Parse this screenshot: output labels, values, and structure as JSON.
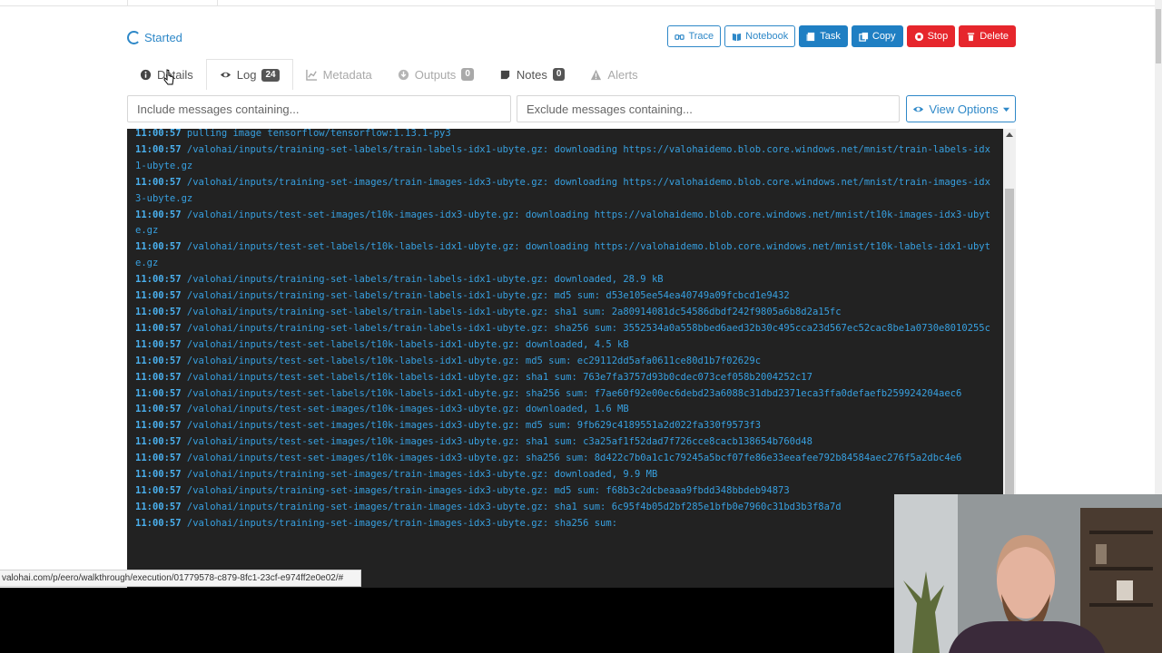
{
  "status": {
    "label": "Started"
  },
  "actions": [
    {
      "label": "Trace",
      "icon": "trace-icon",
      "style": "outline"
    },
    {
      "label": "Notebook",
      "icon": "book-icon",
      "style": "outline"
    },
    {
      "label": "Task",
      "icon": "task-icon",
      "style": "blue"
    },
    {
      "label": "Copy",
      "icon": "copy-icon",
      "style": "blue"
    },
    {
      "label": "Stop",
      "icon": "stop-icon",
      "style": "red"
    },
    {
      "label": "Delete",
      "icon": "trash-icon",
      "style": "red"
    }
  ],
  "tabs": [
    {
      "label": "Details",
      "icon": "info-icon",
      "badge": ""
    },
    {
      "label": "Log",
      "icon": "eye-icon",
      "badge": "24"
    },
    {
      "label": "Metadata",
      "icon": "chart-icon",
      "badge": ""
    },
    {
      "label": "Outputs",
      "icon": "download-icon",
      "badge": "0"
    },
    {
      "label": "Notes",
      "icon": "note-icon",
      "badge": "0"
    },
    {
      "label": "Alerts",
      "icon": "warning-icon",
      "badge": ""
    }
  ],
  "filters": {
    "include_placeholder": "Include messages containing...",
    "exclude_placeholder": "Exclude messages containing...",
    "view_options_label": "View Options"
  },
  "log_lines": [
    {
      "time": "11:00:57",
      "text": "pulling image tensorflow/tensorflow:1.13.1-py3"
    },
    {
      "time": "11:00:57",
      "text": "/valohai/inputs/training-set-labels/train-labels-idx1-ubyte.gz: downloading https://valohaidemo.blob.core.windows.net/mnist/train-labels-idx1-ubyte.gz"
    },
    {
      "time": "11:00:57",
      "text": "/valohai/inputs/training-set-images/train-images-idx3-ubyte.gz: downloading https://valohaidemo.blob.core.windows.net/mnist/train-images-idx3-ubyte.gz"
    },
    {
      "time": "11:00:57",
      "text": "/valohai/inputs/test-set-images/t10k-images-idx3-ubyte.gz: downloading https://valohaidemo.blob.core.windows.net/mnist/t10k-images-idx3-ubyte.gz"
    },
    {
      "time": "11:00:57",
      "text": "/valohai/inputs/test-set-labels/t10k-labels-idx1-ubyte.gz: downloading https://valohaidemo.blob.core.windows.net/mnist/t10k-labels-idx1-ubyte.gz"
    },
    {
      "time": "11:00:57",
      "text": "/valohai/inputs/training-set-labels/train-labels-idx1-ubyte.gz: downloaded, 28.9 kB"
    },
    {
      "time": "11:00:57",
      "text": "/valohai/inputs/training-set-labels/train-labels-idx1-ubyte.gz: md5 sum: d53e105ee54ea40749a09fcbcd1e9432"
    },
    {
      "time": "11:00:57",
      "text": "/valohai/inputs/training-set-labels/train-labels-idx1-ubyte.gz: sha1 sum: 2a80914081dc54586dbdf242f9805a6b8d2a15fc"
    },
    {
      "time": "11:00:57",
      "text": "/valohai/inputs/training-set-labels/train-labels-idx1-ubyte.gz: sha256 sum: 3552534a0a558bbed6aed32b30c495cca23d567ec52cac8be1a0730e8010255c"
    },
    {
      "time": "11:00:57",
      "text": "/valohai/inputs/test-set-labels/t10k-labels-idx1-ubyte.gz: downloaded, 4.5 kB"
    },
    {
      "time": "11:00:57",
      "text": "/valohai/inputs/test-set-labels/t10k-labels-idx1-ubyte.gz: md5 sum: ec29112dd5afa0611ce80d1b7f02629c"
    },
    {
      "time": "11:00:57",
      "text": "/valohai/inputs/test-set-labels/t10k-labels-idx1-ubyte.gz: sha1 sum: 763e7fa3757d93b0cdec073cef058b2004252c17"
    },
    {
      "time": "11:00:57",
      "text": "/valohai/inputs/test-set-labels/t10k-labels-idx1-ubyte.gz: sha256 sum: f7ae60f92e00ec6debd23a6088c31dbd2371eca3ffa0defaefb259924204aec6"
    },
    {
      "time": "11:00:57",
      "text": "/valohai/inputs/test-set-images/t10k-images-idx3-ubyte.gz: downloaded, 1.6 MB"
    },
    {
      "time": "11:00:57",
      "text": "/valohai/inputs/test-set-images/t10k-images-idx3-ubyte.gz: md5 sum: 9fb629c4189551a2d022fa330f9573f3"
    },
    {
      "time": "11:00:57",
      "text": "/valohai/inputs/test-set-images/t10k-images-idx3-ubyte.gz: sha1 sum: c3a25af1f52dad7f726cce8cacb138654b760d48"
    },
    {
      "time": "11:00:57",
      "text": "/valohai/inputs/test-set-images/t10k-images-idx3-ubyte.gz: sha256 sum: 8d422c7b0a1c1c79245a5bcf07fe86e33eeafee792b84584aec276f5a2dbc4e6"
    },
    {
      "time": "11:00:57",
      "text": "/valohai/inputs/training-set-images/train-images-idx3-ubyte.gz: downloaded, 9.9 MB"
    },
    {
      "time": "11:00:57",
      "text": "/valohai/inputs/training-set-images/train-images-idx3-ubyte.gz: md5 sum: f68b3c2dcbeaaa9fbdd348bbdeb94873"
    },
    {
      "time": "11:00:57",
      "text": "/valohai/inputs/training-set-images/train-images-idx3-ubyte.gz: sha1 sum: 6c95f4b05d2bf285e1bfb0e7960c31bd3b3f8a7d"
    },
    {
      "time": "11:00:57",
      "text": "/valohai/inputs/training-set-images/train-images-idx3-ubyte.gz: sha256 sum:"
    }
  ],
  "status_url": "valohai.com/p/eero/walkthrough/execution/01779578-c879-8fc1-23cf-e974ff2e0e02/#"
}
